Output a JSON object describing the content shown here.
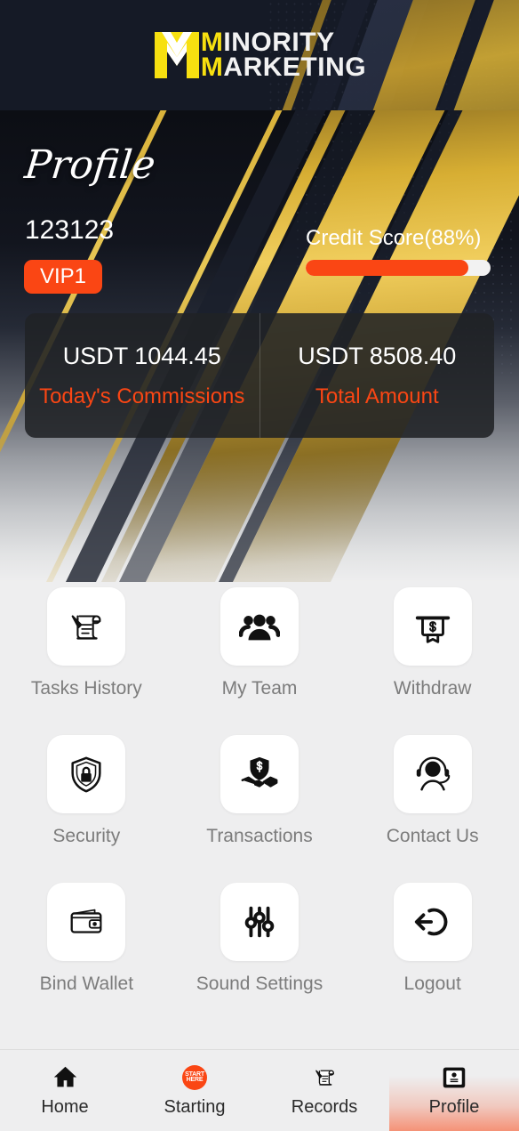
{
  "brand": {
    "logo_mark": "m-chevron-logo",
    "line1_accent": "M",
    "line1_rest": "INORITY",
    "line2_accent": "M",
    "line2_rest": "ARKETING",
    "accent_yellow": "#f7e010",
    "logo_bg": "#151a26"
  },
  "banner": {
    "title": "Profile",
    "username": "123123",
    "vip_badge": "VIP1",
    "credit_label": "Credit Score(88%)",
    "credit_percent": 88,
    "accent_orange": "#fa4614"
  },
  "stats": [
    {
      "value": "USDT 1044.45",
      "label": "Today's Commissions"
    },
    {
      "value": "USDT 8508.40",
      "label": "Total Amount"
    }
  ],
  "menu": [
    {
      "label": "Tasks History",
      "icon": "scroll-quill-icon"
    },
    {
      "label": "My Team",
      "icon": "people-group-icon"
    },
    {
      "label": "Withdraw",
      "icon": "atm-cash-dollar-icon"
    },
    {
      "label": "Security",
      "icon": "shield-lock-icon"
    },
    {
      "label": "Transactions",
      "icon": "shield-dollar-handshake-icon"
    },
    {
      "label": "Contact Us",
      "icon": "headset-support-icon"
    },
    {
      "label": "Bind Wallet",
      "icon": "wallet-icon"
    },
    {
      "label": "Sound Settings",
      "icon": "sliders-icon"
    },
    {
      "label": "Logout",
      "icon": "logout-arrow-icon"
    }
  ],
  "bottom_nav": {
    "items": [
      {
        "label": "Home",
        "icon": "home-icon",
        "active": false
      },
      {
        "label": "Starting",
        "icon": "start-here-icon",
        "active": false,
        "badge_line1": "START",
        "badge_line2": "HERE"
      },
      {
        "label": "Records",
        "icon": "scroll-quill-icon",
        "active": false
      },
      {
        "label": "Profile",
        "icon": "id-card-icon",
        "active": true
      }
    ]
  }
}
